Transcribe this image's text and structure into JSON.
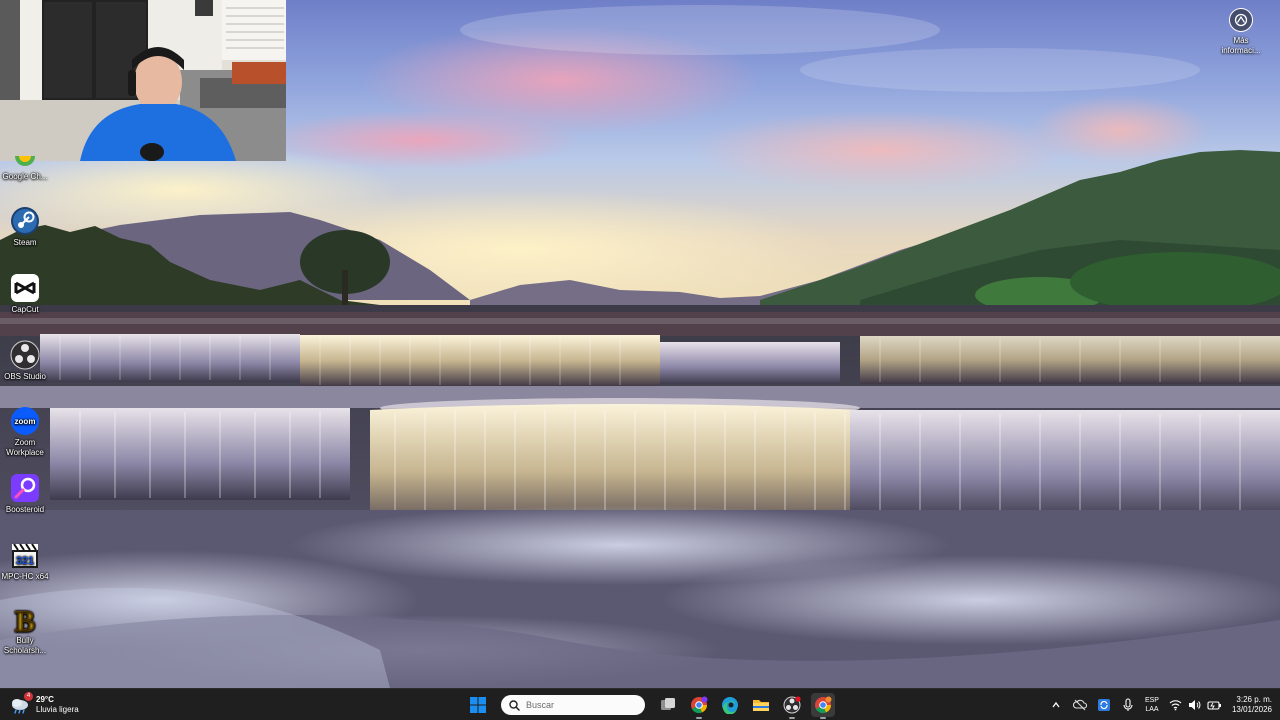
{
  "desktop": {
    "icons": [
      {
        "name": "Google Chrome",
        "label": "Google Ch...",
        "icon": "chrome-icon"
      },
      {
        "name": "Steam",
        "label": "Steam",
        "icon": "steam-icon"
      },
      {
        "name": "CapCut",
        "label": "CapCut",
        "icon": "capcut-icon"
      },
      {
        "name": "OBS Studio",
        "label": "OBS Studio",
        "icon": "obs-icon"
      },
      {
        "name": "Zoom Workplace",
        "label": "Zoom Workplace",
        "icon": "zoom-icon",
        "logo_text": "zoom"
      },
      {
        "name": "Boosteroid",
        "label": "Boosteroid",
        "icon": "boosteroid-icon"
      },
      {
        "name": "MPC-HC x64",
        "label": "MPC-HC x64",
        "icon": "mpc-hc-icon",
        "logo_text": "321"
      },
      {
        "name": "Bully Scholarship",
        "label": "Bully Scholarsh...",
        "icon": "bully-icon",
        "logo_text": "B"
      }
    ],
    "more_info": {
      "label": "Más informaci...",
      "icon": "spotlight-icon"
    }
  },
  "taskbar": {
    "weather": {
      "temp": "29°C",
      "condition": "Lluvia ligera",
      "badge": "4",
      "icon": "weather-rain-icon"
    },
    "start_icon": "windows-start-icon",
    "search": {
      "placeholder": "Buscar",
      "value": "",
      "icon": "search-icon"
    },
    "apps": [
      {
        "name": "Task View",
        "icon": "task-view-icon"
      },
      {
        "name": "Google Chrome",
        "icon": "chrome-icon"
      },
      {
        "name": "Microsoft Edge",
        "icon": "edge-icon"
      },
      {
        "name": "File Explorer",
        "icon": "folder-icon"
      },
      {
        "name": "OBS Studio",
        "icon": "obs-icon"
      },
      {
        "name": "Google Chrome (active)",
        "icon": "chrome-icon"
      }
    ],
    "tray": {
      "language": "ESP",
      "layout": "LAA",
      "time": "3:26 p. m.",
      "date": "13/01/2026"
    }
  },
  "colors": {
    "taskbar_bg": "#1f1f1f",
    "windows_blue": "#1c8ef0",
    "zoom_blue": "#0b5cff",
    "boosteroid_purple": "#7b3cff",
    "notification_red": "#d13438"
  }
}
